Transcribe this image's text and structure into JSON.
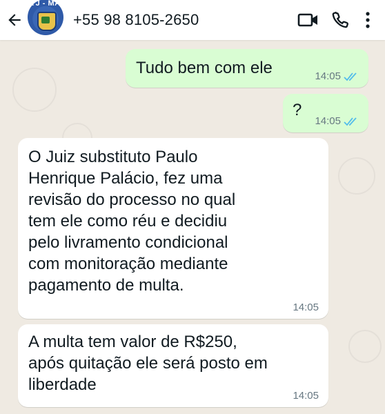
{
  "header": {
    "contact_name": "+55 98 8105-2650",
    "avatar_text": "TJ - MA"
  },
  "messages": [
    {
      "direction": "outgoing",
      "text": "Tudo bem com ele",
      "time": "14:05",
      "status": "read"
    },
    {
      "direction": "outgoing",
      "text": "?",
      "time": "14:05",
      "status": "read"
    },
    {
      "direction": "incoming",
      "lines": [
        "O Juiz substituto Paulo",
        "Henrique Palácio, fez uma",
        "revisão do processo no qual",
        "tem ele como réu e decidiu",
        "pelo livramento condicional",
        "com monitoração mediante",
        "pagamento de multa."
      ],
      "time": "14:05"
    },
    {
      "direction": "incoming",
      "lines": [
        "A multa tem valor de R$250,",
        "após quitação ele será posto em",
        "liberdade"
      ],
      "time": "14:05"
    }
  ],
  "colors": {
    "outgoing_bubble": "#d9fdd3",
    "incoming_bubble": "#ffffff",
    "read_ticks": "#53bdeb",
    "wallpaper": "#efeae2"
  },
  "icons": [
    "back-arrow-icon",
    "video-call-icon",
    "phone-icon",
    "more-options-icon",
    "read-ticks-icon"
  ]
}
